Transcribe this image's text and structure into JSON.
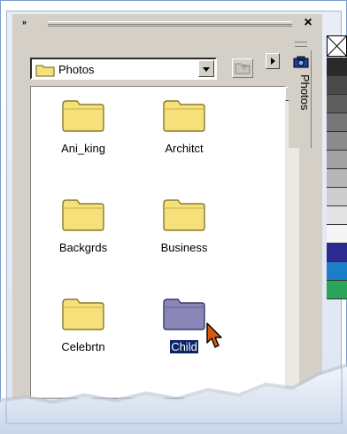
{
  "window": {
    "close_glyph": "×",
    "grip_glyph": "»"
  },
  "toolbar": {
    "folder_select_value": "Photos",
    "up_folder_icon": "up-folder-icon",
    "nav_arrow_icon": "triangle-right-icon"
  },
  "side_tab": {
    "label": "Photos",
    "icon": "camera-icon"
  },
  "folders": [
    {
      "name": "Ani_king"
    },
    {
      "name": "Architct"
    },
    {
      "name": "Backgrds"
    },
    {
      "name": "Business"
    },
    {
      "name": "Celebrtn"
    },
    {
      "name": "Child",
      "selected": true
    }
  ],
  "colors": {
    "panel_bg": "#d4d0c8",
    "folder_yellow": "#f5e07a",
    "folder_selected": "#8a87b8",
    "selection_bg": "#0a246a",
    "palette": [
      "#2a2a2a",
      "#4a4a4a",
      "#5e5e5e",
      "#767676",
      "#8c8c8c",
      "#a2a2a2",
      "#b7b7b7",
      "#cdcdcd",
      "#e3e3e3",
      "#f5f5f5",
      "#2d2a8f",
      "#1a7ec8",
      "#2aa35b"
    ]
  }
}
